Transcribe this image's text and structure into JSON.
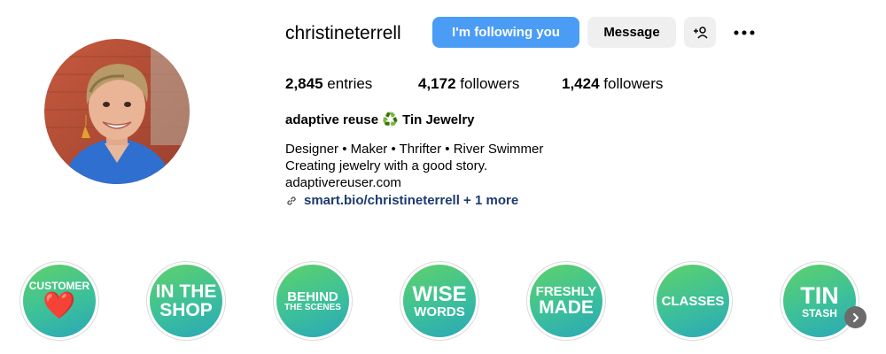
{
  "profile": {
    "username": "christineterrell",
    "following_button": "I'm following you",
    "message_button": "Message",
    "add_user_icon": "add-user-icon",
    "more_icon": "more-options-icon",
    "accent_color": "#4a9cf5",
    "stats": [
      {
        "value": "2,845",
        "label": "entries"
      },
      {
        "value": "4,172",
        "label": "followers"
      },
      {
        "value": "1,424",
        "label": "followers"
      }
    ],
    "full_name": "adaptive reuse ♻️ Tin Jewelry",
    "bio": [
      "Designer • Maker • Thrifter • River Swimmer",
      "Creating jewelry with a good story.",
      "adaptivereuser.com"
    ],
    "link": {
      "icon": "link-icon",
      "text": "smart.bio/christineterrell + 1 more",
      "color": "#1d3a6e"
    }
  },
  "highlights": [
    {
      "lines": [
        "CUSTOMER"
      ],
      "emoji": "❤️"
    },
    {
      "lines": [
        "IN THE",
        "SHOP"
      ]
    },
    {
      "lines": [
        "BEHIND",
        "THE SCENES"
      ]
    },
    {
      "lines": [
        "WISE",
        "WORDS"
      ]
    },
    {
      "lines": [
        "FRESHLY",
        "MADE"
      ]
    },
    {
      "lines": [
        "CLASSES"
      ]
    },
    {
      "lines": [
        "TIN",
        "STASH"
      ]
    }
  ],
  "highlight_gradient": [
    "#5fd16a",
    "#3cc09a",
    "#2aa7b8"
  ],
  "next_icon": "chevron-right-icon"
}
